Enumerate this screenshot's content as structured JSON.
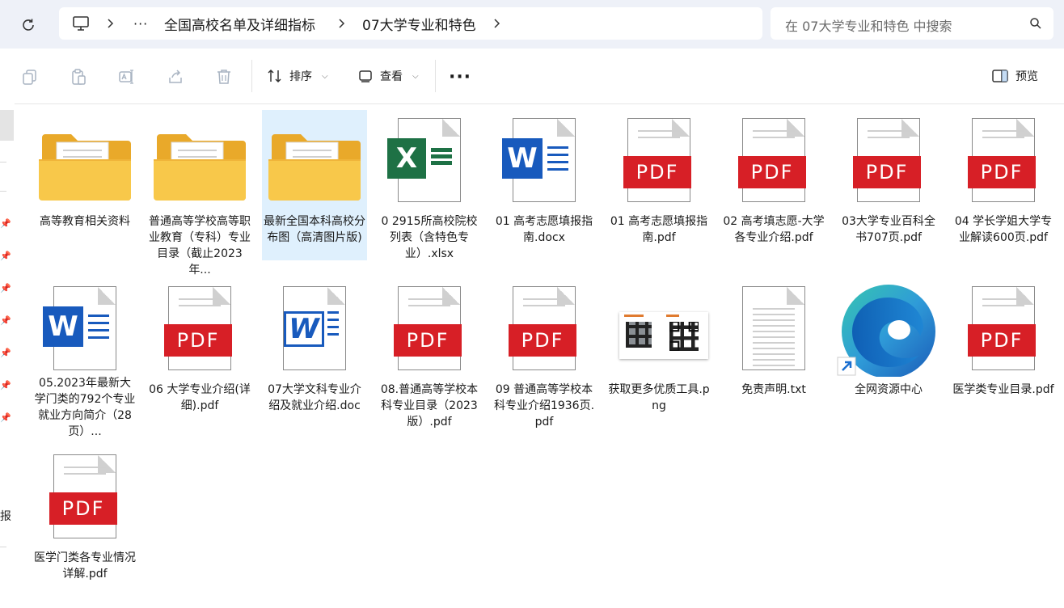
{
  "address": {
    "breadcrumb": [
      {
        "label": "全国高校名单及详细指标"
      },
      {
        "label": "07大学专业和特色"
      }
    ],
    "search_placeholder": "在 07大学专业和特色 中搜索"
  },
  "toolbar": {
    "sort_label": "排序",
    "view_label": "查看",
    "preview_label": "预览"
  },
  "leftnav": {
    "cut_text": "报"
  },
  "files": [
    {
      "name": "高等教育相关资料",
      "icon": "folder-icon"
    },
    {
      "name": "普通高等学校高等职业教育（专科）专业目录（截止2023年...",
      "icon": "folder-icon"
    },
    {
      "name": "最新全国本科高校分布图（高清图片版)",
      "icon": "folder-icon"
    },
    {
      "name": "0 2915所高校院校列表（含特色专业）.xlsx",
      "icon": "excel-icon"
    },
    {
      "name": "01 高考志愿填报指南.docx",
      "icon": "word-icon"
    },
    {
      "name": "01 高考志愿填报指南.pdf",
      "icon": "pdf-icon"
    },
    {
      "name": "02 高考填志愿-大学各专业介绍.pdf",
      "icon": "pdf-icon"
    },
    {
      "name": "03大学专业百科全书707页.pdf",
      "icon": "pdf-icon"
    },
    {
      "name": "04 学长学姐大学专业解读600页.pdf",
      "icon": "pdf-icon"
    },
    {
      "name": "05.2023年最新大学门类的792个专业就业方向简介（28页）...",
      "icon": "word-icon"
    },
    {
      "name": "06 大学专业介绍(详细).pdf",
      "icon": "pdf-icon"
    },
    {
      "name": "07大学文科专业介绍及就业介绍.doc",
      "icon": "word-legacy-icon"
    },
    {
      "name": "08.普通高等学校本科专业目录（2023版）.pdf",
      "icon": "pdf-icon"
    },
    {
      "name": "09 普通高等学校本科专业介绍1936页.pdf",
      "icon": "pdf-icon"
    },
    {
      "name": "获取更多优质工具.png",
      "icon": "image-thumbnail-icon"
    },
    {
      "name": "免责声明.txt",
      "icon": "text-file-icon"
    },
    {
      "name": "全网资源中心",
      "icon": "edge-shortcut-icon"
    },
    {
      "name": "医学类专业目录.pdf",
      "icon": "pdf-icon"
    },
    {
      "name": "医学门类各专业情况详解.pdf",
      "icon": "pdf-icon"
    }
  ],
  "pdf_badge_text": "PDF",
  "excel_letter": "X",
  "word_letter": "W",
  "selected_index": 2,
  "colors": {
    "pdf_red": "#d71f26",
    "excel_green": "#1e7145",
    "word_blue": "#185abd",
    "folder_yellow": "#f8c84a",
    "selection": "#dff0fd"
  }
}
